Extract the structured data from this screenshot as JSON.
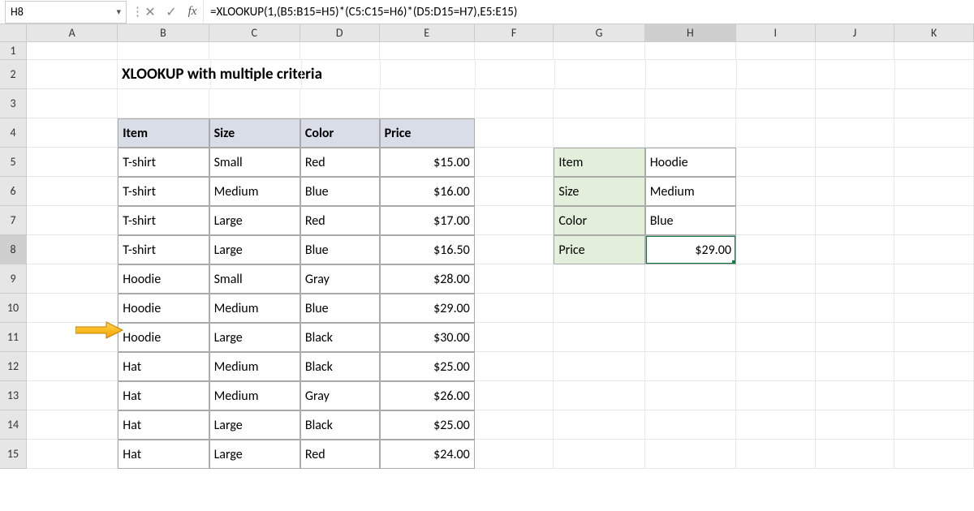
{
  "name_box": "H8",
  "formula": "=XLOOKUP(1,(B5:B15=H5)*(C5:C15=H6)*(D5:D15=H7),E5:E15)",
  "title": "XLOOKUP with multiple criteria",
  "columns": [
    "A",
    "B",
    "C",
    "D",
    "E",
    "F",
    "G",
    "H",
    "I",
    "J",
    "K"
  ],
  "rows": [
    "1",
    "2",
    "3",
    "4",
    "5",
    "6",
    "7",
    "8",
    "9",
    "10",
    "11",
    "12",
    "13",
    "14",
    "15"
  ],
  "active_cell": "H8",
  "active_row": "8",
  "active_col": "H",
  "arrow_row": 10,
  "table": {
    "headers": [
      "Item",
      "Size",
      "Color",
      "Price"
    ],
    "rows": [
      [
        "T-shirt",
        "Small",
        "Red",
        "$15.00"
      ],
      [
        "T-shirt",
        "Medium",
        "Blue",
        "$16.00"
      ],
      [
        "T-shirt",
        "Large",
        "Red",
        "$17.00"
      ],
      [
        "T-shirt",
        "Large",
        "Blue",
        "$16.50"
      ],
      [
        "Hoodie",
        "Small",
        "Gray",
        "$28.00"
      ],
      [
        "Hoodie",
        "Medium",
        "Blue",
        "$29.00"
      ],
      [
        "Hoodie",
        "Large",
        "Black",
        "$30.00"
      ],
      [
        "Hat",
        "Medium",
        "Black",
        "$25.00"
      ],
      [
        "Hat",
        "Medium",
        "Gray",
        "$26.00"
      ],
      [
        "Hat",
        "Large",
        "Black",
        "$25.00"
      ],
      [
        "Hat",
        "Large",
        "Red",
        "$24.00"
      ]
    ]
  },
  "lookup": {
    "labels": [
      "Item",
      "Size",
      "Color",
      "Price"
    ],
    "values": [
      "Hoodie",
      "Medium",
      "Blue",
      "$29.00"
    ]
  },
  "chart_data": {
    "type": "table",
    "title": "XLOOKUP with multiple criteria",
    "columns": [
      "Item",
      "Size",
      "Color",
      "Price"
    ],
    "rows": [
      {
        "Item": "T-shirt",
        "Size": "Small",
        "Color": "Red",
        "Price": 15.0
      },
      {
        "Item": "T-shirt",
        "Size": "Medium",
        "Color": "Blue",
        "Price": 16.0
      },
      {
        "Item": "T-shirt",
        "Size": "Large",
        "Color": "Red",
        "Price": 17.0
      },
      {
        "Item": "T-shirt",
        "Size": "Large",
        "Color": "Blue",
        "Price": 16.5
      },
      {
        "Item": "Hoodie",
        "Size": "Small",
        "Color": "Gray",
        "Price": 28.0
      },
      {
        "Item": "Hoodie",
        "Size": "Medium",
        "Color": "Blue",
        "Price": 29.0
      },
      {
        "Item": "Hoodie",
        "Size": "Large",
        "Color": "Black",
        "Price": 30.0
      },
      {
        "Item": "Hat",
        "Size": "Medium",
        "Color": "Black",
        "Price": 25.0
      },
      {
        "Item": "Hat",
        "Size": "Medium",
        "Color": "Gray",
        "Price": 26.0
      },
      {
        "Item": "Hat",
        "Size": "Large",
        "Color": "Black",
        "Price": 25.0
      },
      {
        "Item": "Hat",
        "Size": "Large",
        "Color": "Red",
        "Price": 24.0
      }
    ],
    "lookup_criteria": {
      "Item": "Hoodie",
      "Size": "Medium",
      "Color": "Blue"
    },
    "lookup_result": {
      "Price": 29.0
    }
  }
}
